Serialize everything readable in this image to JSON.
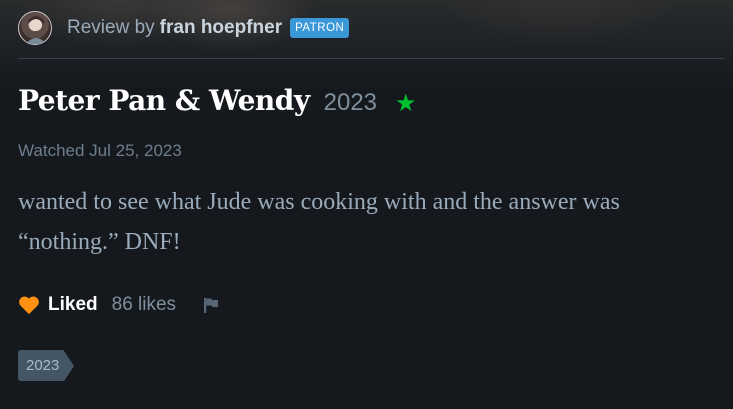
{
  "review_header": {
    "review_by_label": "Review by",
    "reviewer_name": "fran hoepfner",
    "badge": "PATRON"
  },
  "film": {
    "title": "Peter Pan & Wendy",
    "year": "2023",
    "rating_stars": 1,
    "rating_color": "#00c030"
  },
  "watched": "Watched Jul 25, 2023",
  "review_text": "wanted to see what Jude was cooking with and the answer was “nothing.” DNF!",
  "actions": {
    "liked_label": "Liked",
    "likes_count": "86 likes",
    "like_color": "#ff9010",
    "flag_icon": "flag-icon"
  },
  "tags": [
    "2023"
  ],
  "colors": {
    "background": "#15191e",
    "patron_badge": "#3a98d9",
    "tag": "#445566"
  }
}
